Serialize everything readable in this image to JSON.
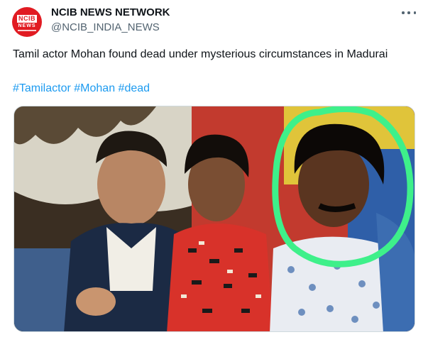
{
  "account": {
    "display_name": "NCIB NEWS NETWORK",
    "handle": "@NCIB_INDIA_NEWS",
    "avatar_text_top": "NCIB",
    "avatar_text_mid": "NEWS"
  },
  "post": {
    "text": "Tamil actor Mohan found dead under mysterious circumstances in Madurai",
    "hashtags": [
      "#Tamilactor",
      "#Mohan",
      "#dead"
    ]
  },
  "media": {
    "icon": "photo",
    "highlight_color": "#3ef08a"
  },
  "icons": {
    "more": "more-horizontal-icon"
  }
}
